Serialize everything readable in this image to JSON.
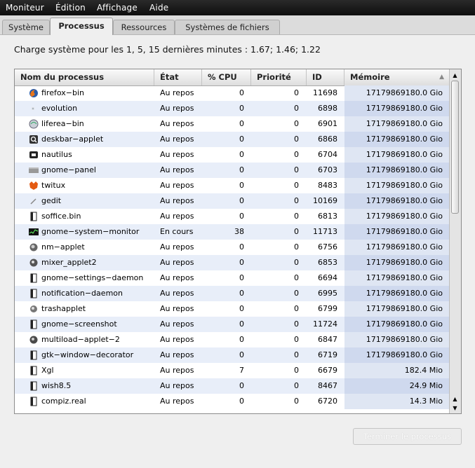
{
  "menu": [
    "Moniteur",
    "Édition",
    "Affichage",
    "Aide"
  ],
  "tabs": [
    "Système",
    "Processus",
    "Ressources",
    "Systèmes de fichiers"
  ],
  "load_text": "Charge système pour les 1, 5, 15 dernières minutes : 1.67; 1.46; 1.22",
  "columns": [
    "Nom du processus",
    "État",
    "% CPU",
    "Priorité",
    "ID",
    "Mémoire"
  ],
  "processes": [
    {
      "name": "firefox−bin",
      "state": "Au repos",
      "cpu": "0",
      "prio": "0",
      "id": "11698",
      "mem": "17179869180.0 Gio",
      "icon": "firefox-icon"
    },
    {
      "name": "evolution",
      "state": "Au repos",
      "cpu": "0",
      "prio": "0",
      "id": "6898",
      "mem": "17179869180.0 Gio",
      "icon": "evolution-icon"
    },
    {
      "name": "liferea−bin",
      "state": "Au repos",
      "cpu": "0",
      "prio": "0",
      "id": "6901",
      "mem": "17179869180.0 Gio",
      "icon": "liferea-icon"
    },
    {
      "name": "deskbar−applet",
      "state": "Au repos",
      "cpu": "0",
      "prio": "0",
      "id": "6868",
      "mem": "17179869180.0 Gio",
      "icon": "deskbar-icon"
    },
    {
      "name": "nautilus",
      "state": "Au repos",
      "cpu": "0",
      "prio": "0",
      "id": "6704",
      "mem": "17179869180.0 Gio",
      "icon": "nautilus-icon"
    },
    {
      "name": "gnome−panel",
      "state": "Au repos",
      "cpu": "0",
      "prio": "0",
      "id": "6703",
      "mem": "17179869180.0 Gio",
      "icon": "panel-icon"
    },
    {
      "name": "twitux",
      "state": "Au repos",
      "cpu": "0",
      "prio": "0",
      "id": "8483",
      "mem": "17179869180.0 Gio",
      "icon": "twitux-icon"
    },
    {
      "name": "gedit",
      "state": "Au repos",
      "cpu": "0",
      "prio": "0",
      "id": "10169",
      "mem": "17179869180.0 Gio",
      "icon": "gedit-icon"
    },
    {
      "name": "soffice.bin",
      "state": "Au repos",
      "cpu": "0",
      "prio": "0",
      "id": "6813",
      "mem": "17179869180.0 Gio",
      "icon": "generic-process-icon"
    },
    {
      "name": "gnome−system−monitor",
      "state": "En cours",
      "cpu": "38",
      "prio": "0",
      "id": "11713",
      "mem": "17179869180.0 Gio",
      "icon": "system-monitor-icon"
    },
    {
      "name": "nm−applet",
      "state": "Au repos",
      "cpu": "0",
      "prio": "0",
      "id": "6756",
      "mem": "17179869180.0 Gio",
      "icon": "network-icon"
    },
    {
      "name": "mixer_applet2",
      "state": "Au repos",
      "cpu": "0",
      "prio": "0",
      "id": "6853",
      "mem": "17179869180.0 Gio",
      "icon": "mixer-icon"
    },
    {
      "name": "gnome−settings−daemon",
      "state": "Au repos",
      "cpu": "0",
      "prio": "0",
      "id": "6694",
      "mem": "17179869180.0 Gio",
      "icon": "generic-process-icon"
    },
    {
      "name": "notification−daemon",
      "state": "Au repos",
      "cpu": "0",
      "prio": "0",
      "id": "6995",
      "mem": "17179869180.0 Gio",
      "icon": "generic-process-icon"
    },
    {
      "name": "trashapplet",
      "state": "Au repos",
      "cpu": "0",
      "prio": "0",
      "id": "6799",
      "mem": "17179869180.0 Gio",
      "icon": "trash-icon"
    },
    {
      "name": "gnome−screenshot",
      "state": "Au repos",
      "cpu": "0",
      "prio": "0",
      "id": "11724",
      "mem": "17179869180.0 Gio",
      "icon": "generic-process-icon"
    },
    {
      "name": "multiload−applet−2",
      "state": "Au repos",
      "cpu": "0",
      "prio": "0",
      "id": "6847",
      "mem": "17179869180.0 Gio",
      "icon": "multiload-icon"
    },
    {
      "name": "gtk−window−decorator",
      "state": "Au repos",
      "cpu": "0",
      "prio": "0",
      "id": "6719",
      "mem": "17179869180.0 Gio",
      "icon": "generic-process-icon"
    },
    {
      "name": "Xgl",
      "state": "Au repos",
      "cpu": "7",
      "prio": "0",
      "id": "6679",
      "mem": "182.4 Mio",
      "icon": "generic-process-icon"
    },
    {
      "name": "wish8.5",
      "state": "Au repos",
      "cpu": "0",
      "prio": "0",
      "id": "8467",
      "mem": "24.9 Mio",
      "icon": "generic-process-icon"
    },
    {
      "name": "compiz.real",
      "state": "Au repos",
      "cpu": "0",
      "prio": "0",
      "id": "6720",
      "mem": "14.3 Mio",
      "icon": "generic-process-icon"
    }
  ],
  "end_button": "Terminer le processus"
}
